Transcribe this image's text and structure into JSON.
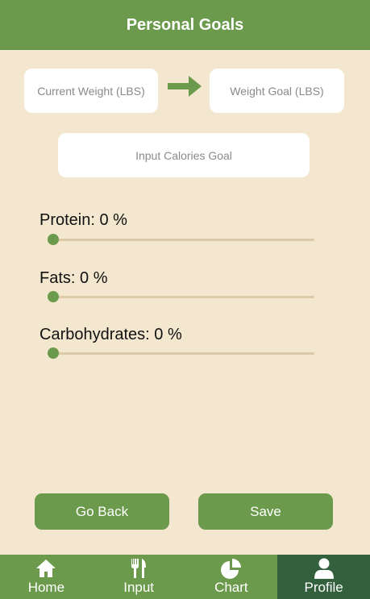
{
  "header": {
    "title": "Personal Goals"
  },
  "inputs": {
    "current_weight_placeholder": "Current Weight (LBS)",
    "weight_goal_placeholder": "Weight Goal (LBS)",
    "calories_placeholder": "Input Calories Goal"
  },
  "sliders": [
    {
      "label": "Protein: 0 %",
      "value_percent": 0
    },
    {
      "label": "Fats: 0 %",
      "value_percent": 0
    },
    {
      "label": "Carbohydrates: 0 %",
      "value_percent": 0
    }
  ],
  "buttons": {
    "go_back": "Go Back",
    "save": "Save"
  },
  "nav": {
    "items": [
      {
        "label": "Home",
        "icon": "home-icon",
        "active": false
      },
      {
        "label": "Input",
        "icon": "utensils-icon",
        "active": false
      },
      {
        "label": "Chart",
        "icon": "pie-chart-icon",
        "active": false
      },
      {
        "label": "Profile",
        "icon": "user-icon",
        "active": true
      }
    ]
  },
  "colors": {
    "background": "#f3e7d0",
    "accent": "#6b9a4c",
    "active_tab": "#33613d",
    "slider_track": "#dcc9a8"
  }
}
